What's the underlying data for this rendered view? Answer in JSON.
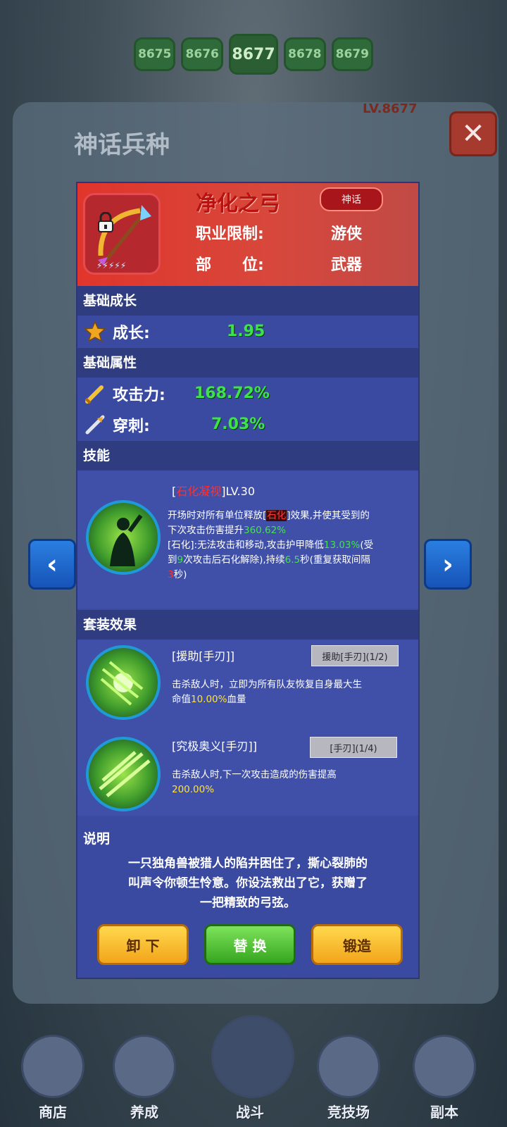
{
  "background": {
    "stages": [
      "8675",
      "8676",
      "8677",
      "8678",
      "8679"
    ],
    "current_stage": "8677",
    "level_text": "LV.8677",
    "panel_title": "神话兵种"
  },
  "modal": {
    "item": {
      "name": "净化之弓",
      "rarity_badge": "神话",
      "class_label": "职业限制:",
      "class_value": "游侠",
      "slot_label": "部　　位:",
      "slot_value": "武器",
      "locked": true
    },
    "growth": {
      "section": "基础成长",
      "label": "成长:",
      "value": "1.95"
    },
    "attributes": {
      "section": "基础属性",
      "attack_label": "攻击力:",
      "attack_value": "168.72%",
      "pierce_label": "穿刺:",
      "pierce_value": "7.03%"
    },
    "skill": {
      "section": "技能",
      "name_pre": "[",
      "name": "石化凝视",
      "name_post": "]LV.30",
      "line1_a": "开场时对所有单位释放[",
      "line1_tag": "石化",
      "line1_b": "]效果,并使其受到的",
      "line2_a": "下次攻击伤害提升",
      "line2_val": "360.62%",
      "line3_a": "[石化]:无法攻击和移动,攻击护甲降低",
      "line3_val": "13.03%",
      "line3_b": "(受",
      "line4_a": "到",
      "line4_val1": "9",
      "line4_b": "次攻击后石化解除),持续",
      "line4_val2": "6.5",
      "line4_c": "秒(重复获取间隔",
      "line5_val": "3",
      "line5_b": "秒)"
    },
    "set_effects": {
      "section": "套装效果",
      "effect1": {
        "name": "[援助[手刃]]",
        "tag": "援助[手刃](1/2)",
        "text_a": "击杀敌人时，立即为所有队友恢复自身最大生",
        "text_b": "命值",
        "text_val": "10.00%",
        "text_c": "血量"
      },
      "effect2": {
        "name": "[究极奥义[手刃]]",
        "tag": "[手刃](1/4)",
        "text_a": "击杀敌人时,下一次攻击造成的伤害提高",
        "text_val": "200.00%"
      }
    },
    "description": {
      "section": "说明",
      "line1": "一只独角兽被猎人的陷井困住了，撕心裂肺的",
      "line2": "叫声令你顿生怜意。你设法救出了它，获赠了",
      "line3": "一把精致的弓弦。"
    },
    "buttons": {
      "unequip": "卸 下",
      "replace": "替 换",
      "forge": "锻造"
    }
  },
  "bottom_nav": [
    "商店",
    "养成",
    "战斗",
    "竞技场",
    "副本"
  ],
  "colors": {
    "modal_bg": "#3a4aa0",
    "header_red": "#e0352b",
    "stat_green": "#3ee34a",
    "highlight_yellow": "#ffe33b"
  }
}
